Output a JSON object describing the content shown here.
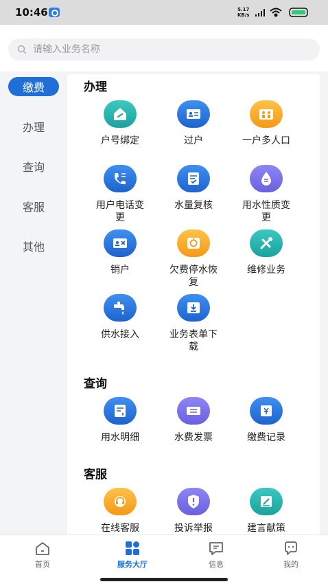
{
  "status_bar": {
    "time": "10:46",
    "speed_value": "5.17",
    "speed_unit": "KB/s"
  },
  "search": {
    "placeholder": "请输入业务名称"
  },
  "sidebar": {
    "items": [
      {
        "label": "缴费",
        "active": true
      },
      {
        "label": "办理",
        "active": false
      },
      {
        "label": "查询",
        "active": false
      },
      {
        "label": "客服",
        "active": false
      },
      {
        "label": "其他",
        "active": false
      }
    ]
  },
  "sections": {
    "handle": {
      "title": "办理",
      "items": [
        {
          "label": "户号绑定",
          "icon": "home-link-icon",
          "color": "teal"
        },
        {
          "label": "过户",
          "icon": "transfer-card-icon",
          "color": "blue"
        },
        {
          "label": "一户多人口",
          "icon": "family-icon",
          "color": "orange"
        },
        {
          "label": "用户电话变更",
          "icon": "phone-change-icon",
          "color": "blue"
        },
        {
          "label": "水量复核",
          "icon": "check-doc-icon",
          "color": "blue"
        },
        {
          "label": "用水性质变更",
          "icon": "water-drop-change-icon",
          "color": "purple"
        },
        {
          "label": "销户",
          "icon": "cancel-card-icon",
          "color": "blue"
        },
        {
          "label": "欠费停水恢复",
          "icon": "restore-icon",
          "color": "orange"
        },
        {
          "label": "维修业务",
          "icon": "repair-tools-icon",
          "color": "teal"
        },
        {
          "label": "供水接入",
          "icon": "faucet-icon",
          "color": "blue"
        },
        {
          "label": "业务表单下载",
          "icon": "download-icon",
          "color": "blue"
        }
      ]
    },
    "query": {
      "title": "查询",
      "items": [
        {
          "label": "用水明细",
          "icon": "water-detail-icon",
          "color": "blue"
        },
        {
          "label": "水费发票",
          "icon": "invoice-icon",
          "color": "purple"
        },
        {
          "label": "缴费记录",
          "icon": "payment-record-icon",
          "color": "blue"
        }
      ]
    },
    "service": {
      "title": "客服",
      "items": [
        {
          "label": "在线客服",
          "icon": "headset-icon",
          "color": "orange"
        },
        {
          "label": "投诉举报",
          "icon": "shield-alert-icon",
          "color": "purple"
        },
        {
          "label": "建言献策",
          "icon": "suggestion-icon",
          "color": "teal"
        }
      ]
    }
  },
  "tabbar": {
    "items": [
      {
        "label": "首页",
        "icon": "home-icon",
        "active": false
      },
      {
        "label": "服务大厅",
        "icon": "service-hall-icon",
        "active": true
      },
      {
        "label": "信息",
        "icon": "message-icon",
        "active": false
      },
      {
        "label": "我的",
        "icon": "profile-icon",
        "active": false
      }
    ]
  },
  "colors": {
    "accent": "#1f6fd6",
    "teal": "#22b0aa",
    "orange": "#f5a623",
    "purple": "#7a72e8"
  }
}
